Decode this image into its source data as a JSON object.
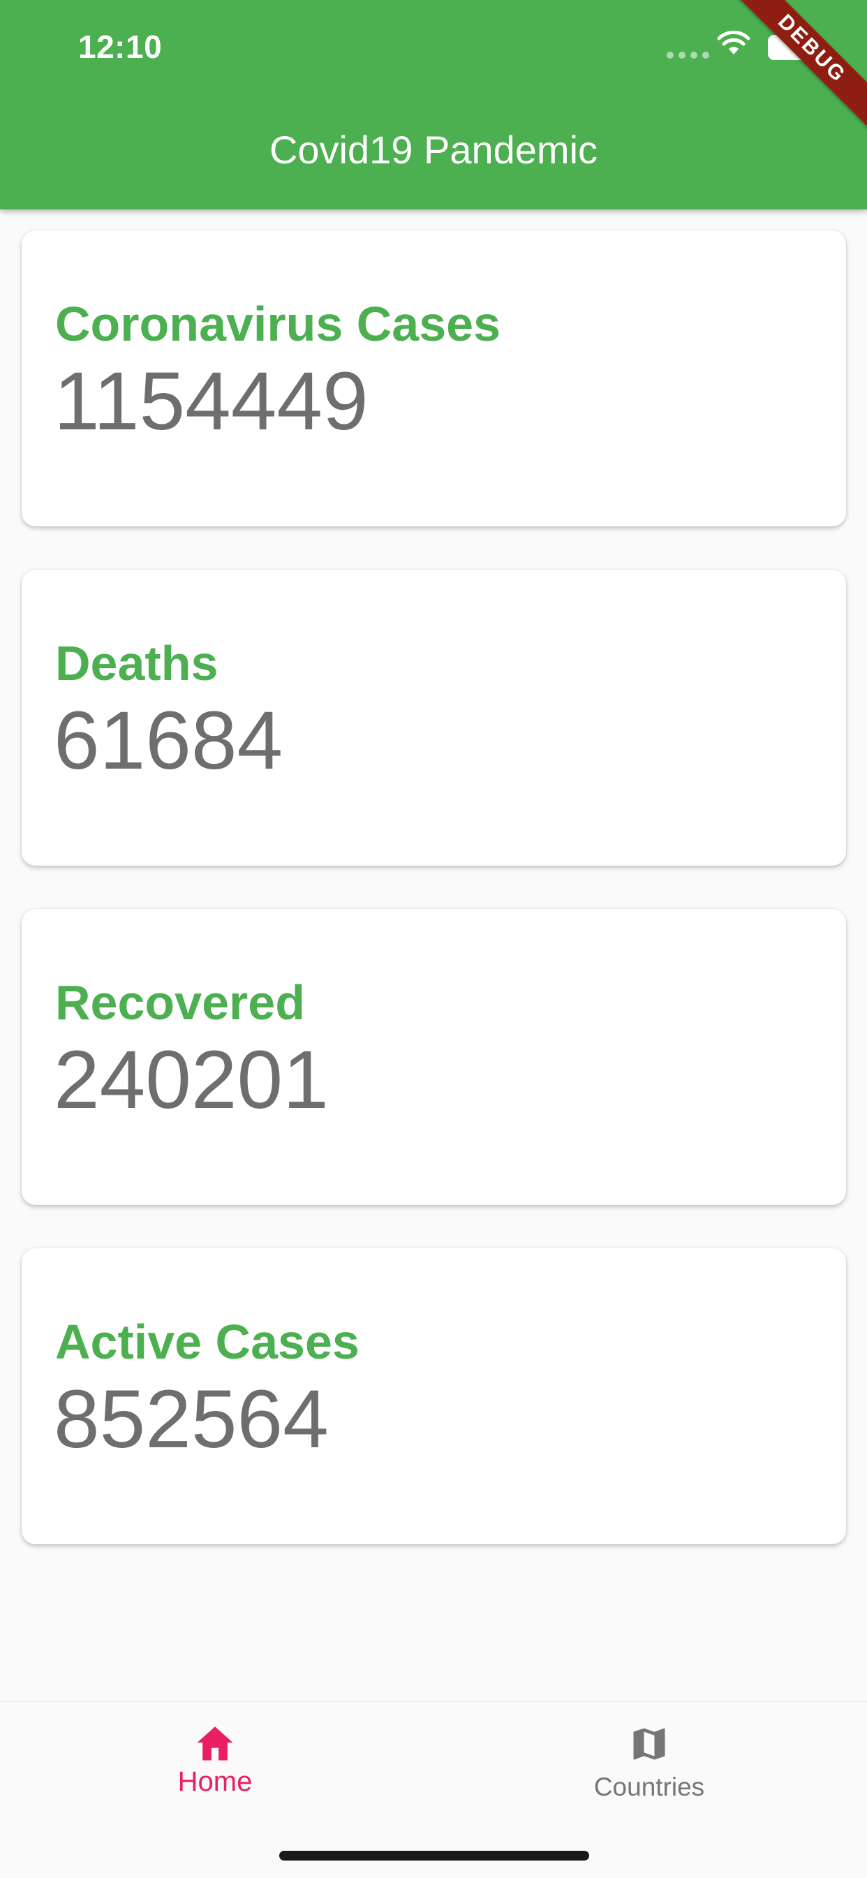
{
  "status_bar": {
    "time": "12:10"
  },
  "debug_banner": "DEBUG",
  "app_bar": {
    "title": "Covid19 Pandemic"
  },
  "colors": {
    "primary": "#4caf50",
    "nav_active": "#e91e63",
    "value_text": "#6e6e6e"
  },
  "cards": [
    {
      "label": "Coronavirus Cases",
      "value": "1154449"
    },
    {
      "label": "Deaths",
      "value": "61684"
    },
    {
      "label": "Recovered",
      "value": "240201"
    },
    {
      "label": "Active Cases",
      "value": "852564"
    }
  ],
  "bottom_nav": {
    "items": [
      {
        "label": "Home",
        "icon": "home-icon",
        "active": true
      },
      {
        "label": "Countries",
        "icon": "map-icon",
        "active": false
      }
    ]
  }
}
